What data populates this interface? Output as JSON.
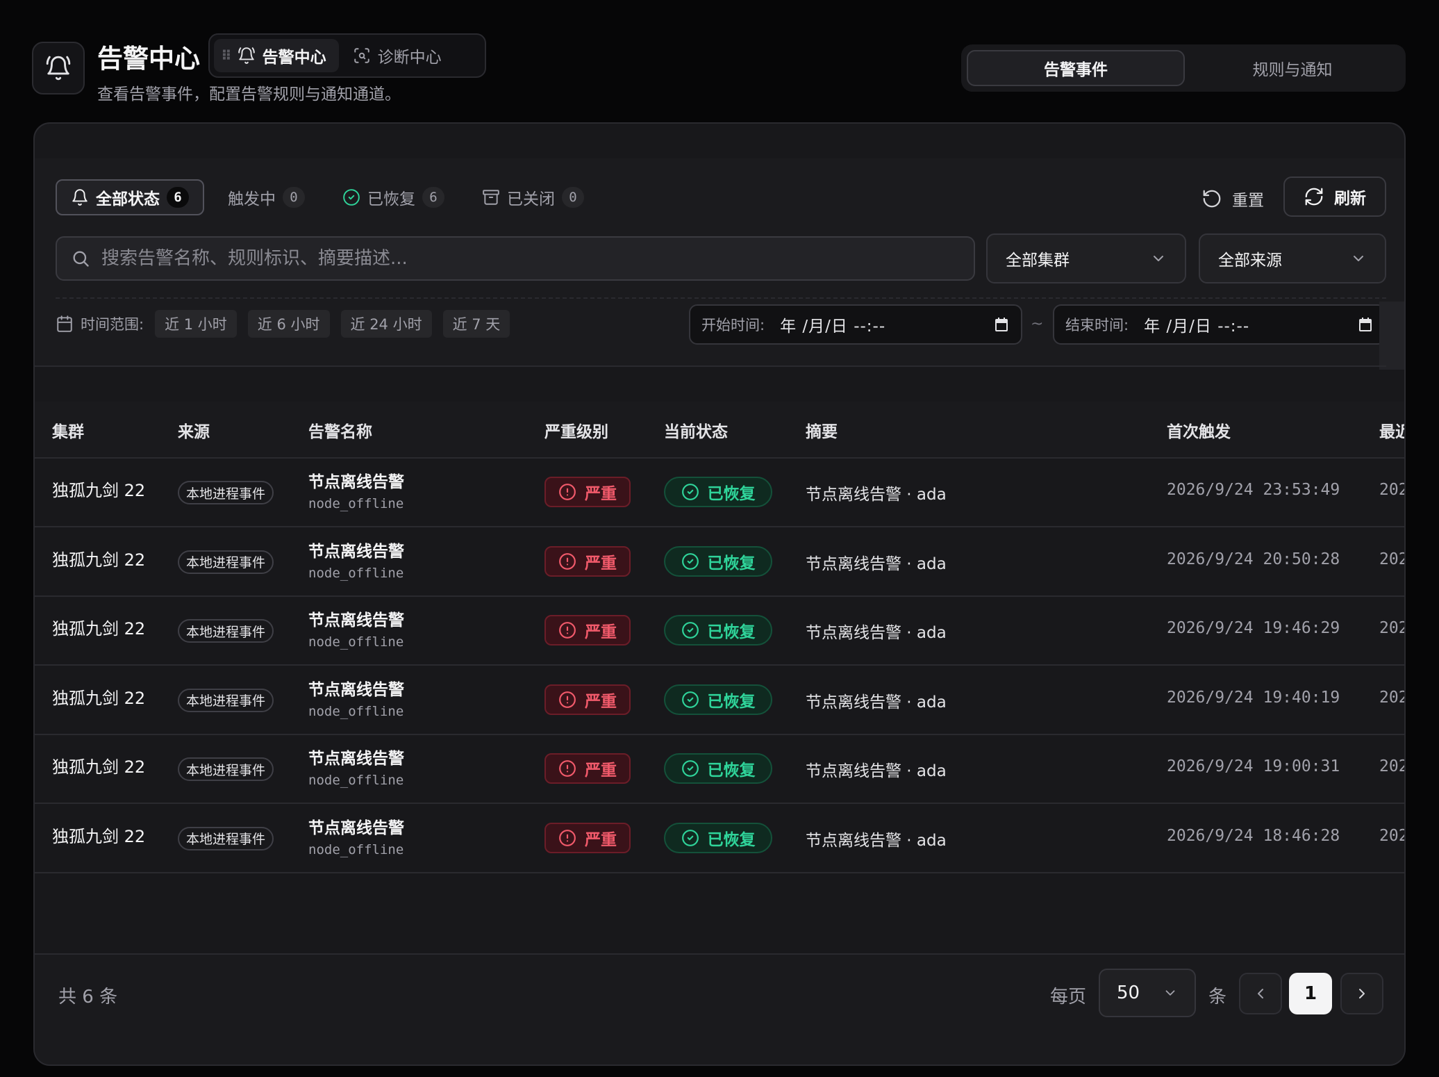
{
  "header": {
    "title": "告警中心",
    "subtitle": "查看告警事件，配置告警规则与通知通道。",
    "modules": [
      {
        "label": "告警中心",
        "icon": "bell-icon",
        "active": true
      },
      {
        "label": "诊断中心",
        "icon": "scan-search-icon",
        "active": false
      }
    ]
  },
  "view_tabs": [
    {
      "label": "告警事件",
      "active": true
    },
    {
      "label": "规则与通知",
      "active": false
    }
  ],
  "status_tabs": [
    {
      "label": "全部状态",
      "count": "6",
      "icon": "bell-icon",
      "active": true
    },
    {
      "label": "触发中",
      "count": "0",
      "icon": "",
      "active": false
    },
    {
      "label": "已恢复",
      "count": "6",
      "icon": "check-circle-icon",
      "active": false
    },
    {
      "label": "已关闭",
      "count": "0",
      "icon": "archive-icon",
      "active": false
    }
  ],
  "actions": {
    "reset_label": "重置",
    "refresh_label": "刷新"
  },
  "search": {
    "placeholder": "搜索告警名称、规则标识、摘要描述..."
  },
  "filters": {
    "cluster": "全部集群",
    "source": "全部来源"
  },
  "time_range": {
    "label": "时间范围:",
    "presets": [
      "近 1 小时",
      "近 6 小时",
      "近 24 小时",
      "近 7 天"
    ],
    "start_label": "开始时间:",
    "end_label": "结束时间:",
    "date_placeholder": "年 /月/日 --:--",
    "separator": "~"
  },
  "table": {
    "columns": [
      "集群",
      "来源",
      "告警名称",
      "严重级别",
      "当前状态",
      "摘要",
      "首次触发",
      "最近"
    ],
    "rows": [
      {
        "cluster": "独孤九剑 22",
        "source": "本地进程事件",
        "name": "节点离线告警",
        "rule": "node_offline",
        "severity": "严重",
        "status": "已恢复",
        "summary": "节点离线告警 · ada",
        "first": "2026/9/24 23:53:49",
        "last": "202"
      },
      {
        "cluster": "独孤九剑 22",
        "source": "本地进程事件",
        "name": "节点离线告警",
        "rule": "node_offline",
        "severity": "严重",
        "status": "已恢复",
        "summary": "节点离线告警 · ada",
        "first": "2026/9/24 20:50:28",
        "last": "202"
      },
      {
        "cluster": "独孤九剑 22",
        "source": "本地进程事件",
        "name": "节点离线告警",
        "rule": "node_offline",
        "severity": "严重",
        "status": "已恢复",
        "summary": "节点离线告警 · ada",
        "first": "2026/9/24 19:46:29",
        "last": "202"
      },
      {
        "cluster": "独孤九剑 22",
        "source": "本地进程事件",
        "name": "节点离线告警",
        "rule": "node_offline",
        "severity": "严重",
        "status": "已恢复",
        "summary": "节点离线告警 · ada",
        "first": "2026/9/24 19:40:19",
        "last": "202"
      },
      {
        "cluster": "独孤九剑 22",
        "source": "本地进程事件",
        "name": "节点离线告警",
        "rule": "node_offline",
        "severity": "严重",
        "status": "已恢复",
        "summary": "节点离线告警 · ada",
        "first": "2026/9/24 19:00:31",
        "last": "202"
      },
      {
        "cluster": "独孤九剑 22",
        "source": "本地进程事件",
        "name": "节点离线告警",
        "rule": "node_offline",
        "severity": "严重",
        "status": "已恢复",
        "summary": "节点离线告警 · ada",
        "first": "2026/9/24 18:46:28",
        "last": "202"
      }
    ]
  },
  "pagination": {
    "total": "共 6 条",
    "per_page_label": "每页",
    "page_size": "50",
    "unit": "条",
    "current_page": "1"
  },
  "colors": {
    "danger": "#f25a6b",
    "success": "#2fd49a",
    "background": "#060607",
    "card": "#18181b"
  }
}
